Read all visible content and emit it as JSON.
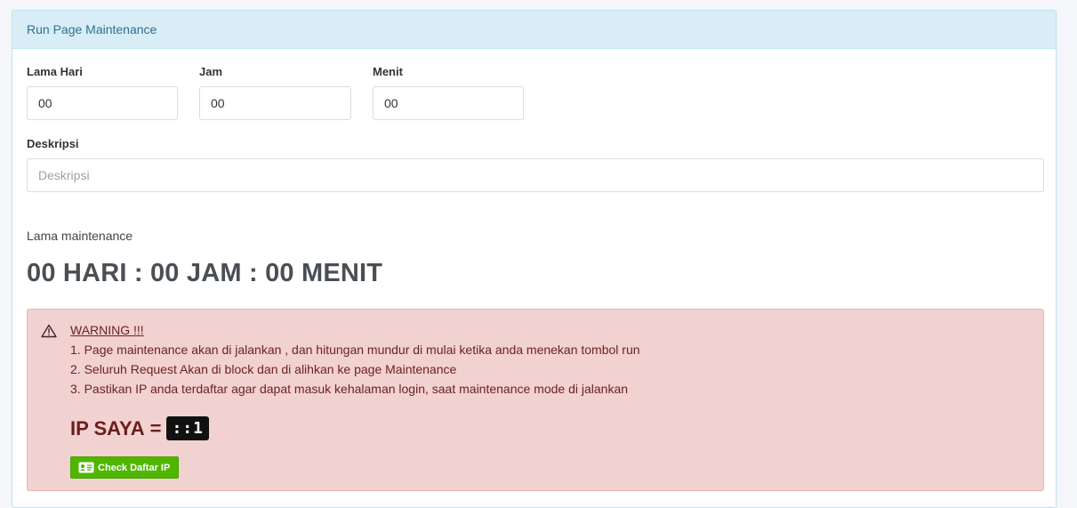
{
  "card": {
    "title": "Run Page Maintenance"
  },
  "form": {
    "days": {
      "label": "Lama Hari",
      "value": "00"
    },
    "hours": {
      "label": "Jam",
      "value": "00"
    },
    "minutes": {
      "label": "Menit",
      "value": "00"
    },
    "description": {
      "label": "Deskripsi",
      "value": "",
      "placeholder": "Deskripsi"
    }
  },
  "duration": {
    "label": "Lama maintenance",
    "display": "00 HARI : 00 JAM : 00 MENIT"
  },
  "warning": {
    "icon": "warning-triangle-icon",
    "title": "WARNING !!!",
    "lines": [
      "1. Page maintenance akan di jalankan , dan hitungan mundur di mulai ketika anda menekan tombol run",
      "2. Seluruh Request Akan di block dan di alihkan ke page Maintenance",
      "3. Pastikan IP anda terdaftar agar dapat masuk kehalaman login, saat maintenance mode di jalankan"
    ],
    "ip_label": "IP SAYA",
    "ip_equals": "=",
    "ip_value": "::1",
    "check_button": {
      "label": "Check Daftar IP",
      "icon": "id-card-icon"
    }
  },
  "colors": {
    "header_bg": "#d9edf7",
    "alert_bg": "#f2d1d1",
    "alert_text": "#6b2322",
    "button_bg": "#4fb600"
  }
}
